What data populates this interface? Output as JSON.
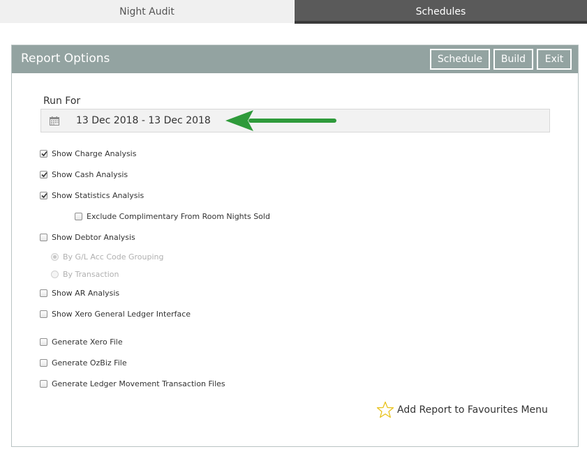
{
  "tabs": [
    {
      "label": "Night Audit",
      "active": false
    },
    {
      "label": "Schedules",
      "active": true
    }
  ],
  "panel": {
    "title": "Report Options",
    "buttons": {
      "schedule": "Schedule",
      "build": "Build",
      "exit": "Exit"
    }
  },
  "run_for": {
    "label": "Run For",
    "value": "13 Dec 2018 - 13 Dec 2018",
    "icon": "calendar-icon"
  },
  "options": [
    {
      "label": "Show Charge Analysis",
      "checked": true
    },
    {
      "label": "Show Cash Analysis",
      "checked": true
    },
    {
      "label": "Show Statistics Analysis",
      "checked": true
    },
    {
      "label": "Exclude Complimentary From Room Nights Sold",
      "checked": false
    },
    {
      "label": "Show Debtor Analysis",
      "checked": false
    },
    {
      "label": "By G/L Acc Code Grouping",
      "selected": true,
      "disabled": true
    },
    {
      "label": "By Transaction",
      "selected": false,
      "disabled": true
    },
    {
      "label": "Show AR Analysis",
      "checked": false
    },
    {
      "label": "Show Xero General Ledger Interface",
      "checked": false
    },
    {
      "label": "Generate Xero File",
      "checked": false
    },
    {
      "label": "Generate OzBiz File",
      "checked": false
    },
    {
      "label": "Generate Ledger Movement Transaction Files",
      "checked": false
    }
  ],
  "favourites": {
    "label": "Add Report to Favourites Menu",
    "icon": "star-icon"
  },
  "colors": {
    "header_bg": "#93a3a1",
    "active_tab": "#5a5a5a",
    "annotation_arrow": "#2e9a3a"
  }
}
